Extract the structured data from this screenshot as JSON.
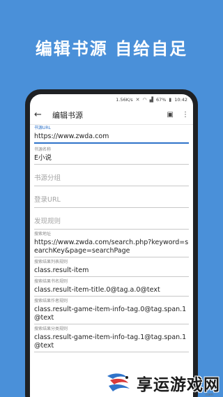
{
  "headline": "编辑书源  自给自足",
  "status": {
    "speed": "1.56K/s",
    "battery": "67%",
    "time": "10:42"
  },
  "appbar": {
    "back_icon": "arrow-left-icon",
    "title": "编辑书源",
    "save_icon": "save-icon",
    "more_icon": "more-vert-icon"
  },
  "fields": {
    "source_url": {
      "label": "书源URL",
      "value": "https://www.zwda.com"
    },
    "source_name": {
      "label": "书源名称",
      "value": "E小说"
    },
    "source_group": {
      "placeholder": "书源分组"
    },
    "login_url": {
      "placeholder": "登录URL"
    },
    "discover_rule": {
      "placeholder": "发现规则"
    },
    "search_url": {
      "label": "搜索地址",
      "value": "https://www.zwda.com/search.php?keyword=searchKey&page=searchPage"
    },
    "search_list": {
      "label": "搜索结果列表规则",
      "value": "class.result-item"
    },
    "search_name": {
      "label": "搜索结果书名规则",
      "value": "class.result-item-title.0@tag.a.0@text"
    },
    "search_author": {
      "label": "搜索结果作者规则",
      "value": "class.result-game-item-info-tag.0@tag.span.1@text"
    },
    "search_kind": {
      "label": "搜索结果分类规则",
      "value": "class.result-game-item-info-tag.1@tag.span.1@text"
    }
  },
  "watermark": {
    "text": "享运游戏网",
    "sub": ".com"
  },
  "colors": {
    "background": "#4a90d9",
    "accent": "#2f73c9"
  }
}
